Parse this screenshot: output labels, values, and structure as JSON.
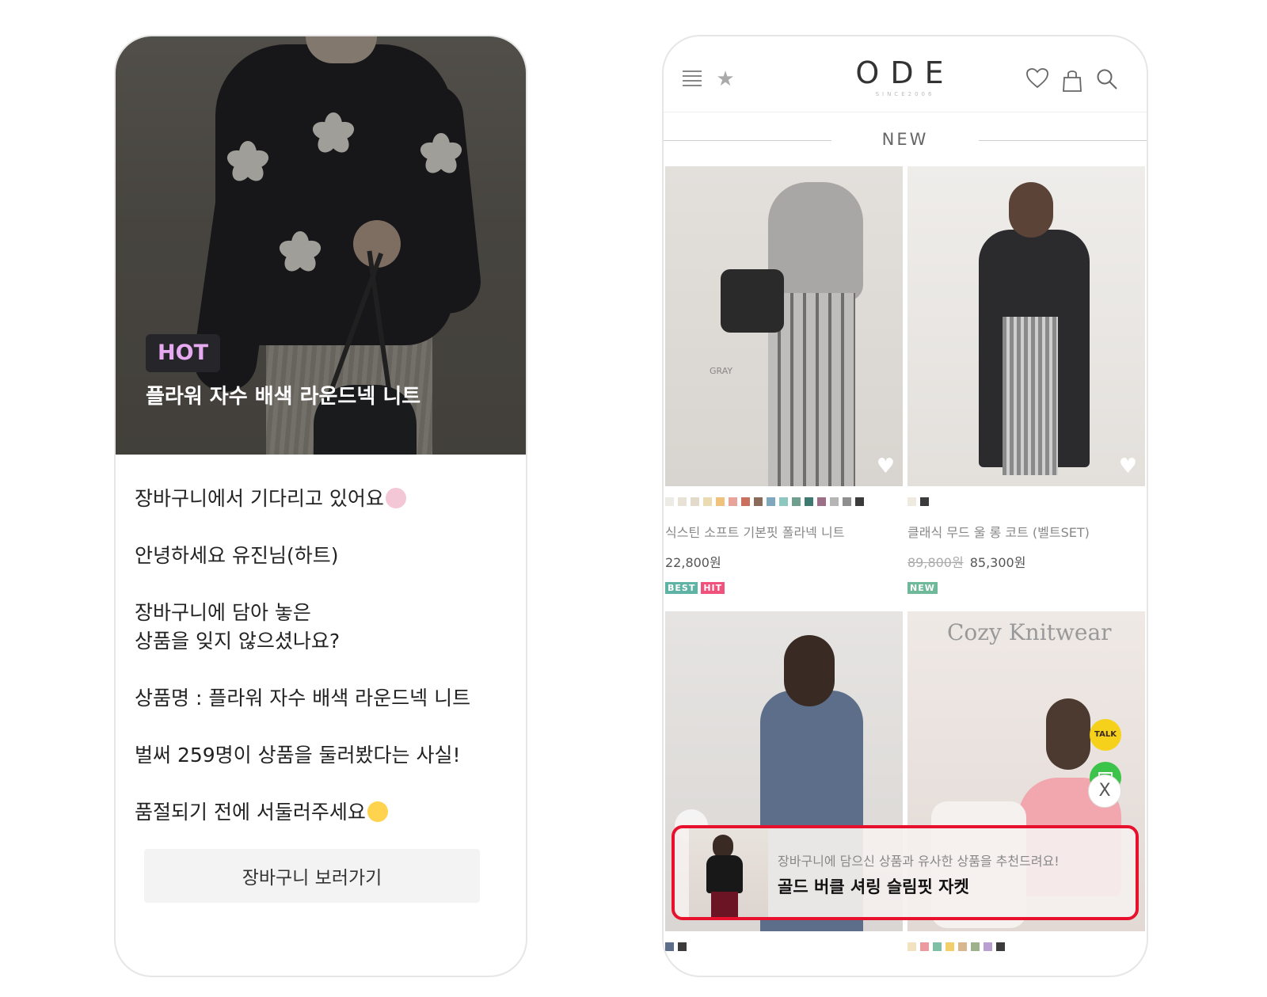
{
  "left": {
    "badge": "HOT",
    "hero_title": "플라워 자수 배색 라운드넥 니트",
    "messages": [
      "장바구니에서 기다리고 있어요",
      "안녕하세요 유진님(하트)",
      "장바구니에 담아 놓은\n상품을 잊지 않으셨나요?",
      "상품명 : 플라워 자수 배색 라운드넥 니트",
      "벌써 259명이 상품을 둘러봤다는 사실!",
      "품절되기 전에 서둘러주세요"
    ],
    "button": "장바구니 보러가기"
  },
  "right": {
    "logo": "ODE",
    "logo_sub": "SINCE2006",
    "icons": [
      "menu-icon",
      "star-icon",
      "heart-icon",
      "bag-icon",
      "search-icon"
    ],
    "section_title": "NEW",
    "products": [
      {
        "name": "식스틴 소프트 기본핏 폴라넥 니트",
        "price": "22,800원",
        "old_price": "",
        "tags": [
          "BEST",
          "HIT"
        ],
        "image_text": "GRAY",
        "swatches": [
          "#ecebe6",
          "#e7e1d6",
          "#e2dbca",
          "#eadbb0",
          "#f1c27b",
          "#e8a39a",
          "#c9705e",
          "#8a6a58",
          "#7fa8bf",
          "#8cc7c0",
          "#6f9f8e",
          "#3f7a70",
          "#9d6f86",
          "#b5b5b5",
          "#8f8f8f",
          "#3b3b3b"
        ]
      },
      {
        "name": "클래식 무드 울 롱 코트 (벨트SET)",
        "price": "85,300원",
        "old_price": "89,800원",
        "tags": [
          "NEW"
        ],
        "image_text": "",
        "swatches": [
          "#eeeadf",
          "#3b3b3b"
        ]
      },
      {
        "name": "",
        "price": "",
        "old_price": "",
        "tags": [],
        "image_text": "",
        "swatches": [
          "#5d6e8a",
          "#3b3b3b"
        ]
      },
      {
        "name": "",
        "price": "",
        "old_price": "",
        "tags": [],
        "image_text": "Cozy Knitwear",
        "swatches": [
          "#f2e2bf",
          "#ec9aa0",
          "#7fbfa5",
          "#f2cf6b",
          "#d8b78e",
          "#9fb08c",
          "#b9a0d1",
          "#3b3b3b"
        ]
      }
    ],
    "fab_talk": "TALK",
    "close": "X",
    "reco_sub": "장바구니에 담으신 상품과 유사한 상품을 추천드려요!",
    "reco_title": "골드 버클 셔링 슬림핏 자켓",
    "colors": {
      "highlight": "#e8112d",
      "tag_best": "#5fb3a4",
      "tag_hit": "#f0527c",
      "tag_new": "#6fb89a",
      "hot_text": "#e7a9ef"
    }
  }
}
